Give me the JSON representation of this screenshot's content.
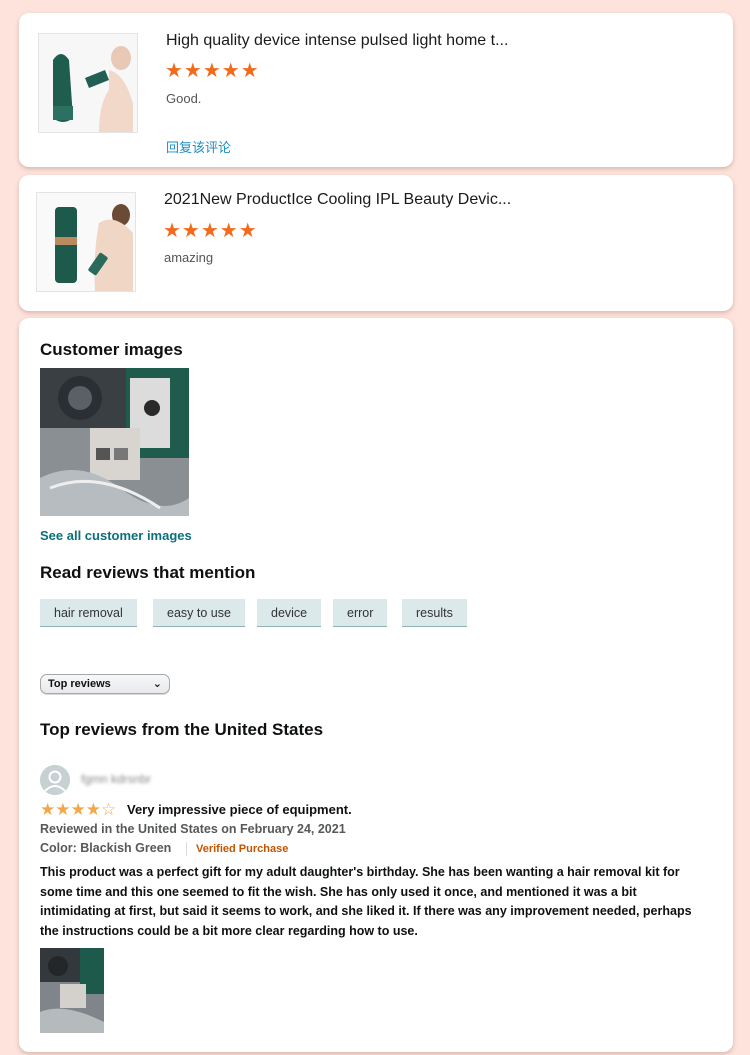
{
  "products": [
    {
      "title": "High quality device intense pulsed light home t...",
      "stars": "★★★★★",
      "text": "Good.",
      "reply": "回复该评论"
    },
    {
      "title": "2021New ProductIce Cooling IPL Beauty Devic...",
      "stars": "★★★★★",
      "text": "amazing"
    }
  ],
  "customer_images": {
    "heading": "Customer images",
    "see_all": "See all customer images"
  },
  "mentions": {
    "heading": "Read reviews that mention",
    "chips": [
      "hair removal",
      "easy to use",
      "device",
      "error",
      "results"
    ]
  },
  "sort": {
    "selected": "Top reviews"
  },
  "top_reviews": {
    "heading": "Top reviews from the United States"
  },
  "review": {
    "reviewer": "fgmn kdrsnbr",
    "stars": "★★★★☆",
    "title": "Very impressive piece of equipment.",
    "date_line": "Reviewed in the United States on February 24, 2021",
    "color": "Color: Blackish Green",
    "verified": "Verified Purchase",
    "body": "This product was a perfect gift for my adult daughter's birthday. She has been wanting a hair removal kit for some time and this one seemed to fit the wish. She has only used it once, and mentioned it was a bit intimidating at first, but said it seems to work, and she liked it. If there was any improvement needed, perhaps the instructions could be a bit more clear regarding how to use."
  },
  "colors": {
    "background": "#fde3dc",
    "star_orange": "#f26b1d",
    "review_star": "#f3a847",
    "teal_link": "#0b6f7d",
    "reply_link": "#1d8fc3",
    "verified": "#c45500"
  }
}
